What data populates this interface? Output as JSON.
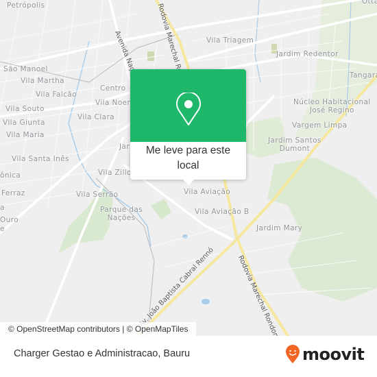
{
  "map": {
    "labels": [
      {
        "text": "Petrópolis"
      },
      {
        "text": "São Manoel"
      },
      {
        "text": "Vila Martha"
      },
      {
        "text": "Vila Falcão"
      },
      {
        "text": "Centro"
      },
      {
        "text": "Vila Noem"
      },
      {
        "text": "Vila Souto"
      },
      {
        "text": "Vila Clara"
      },
      {
        "text": "Vila Giunta"
      },
      {
        "text": "Vila Maria"
      },
      {
        "text": "Vila Santa Inês"
      },
      {
        "text": "ônica"
      },
      {
        "text": "Ferraz"
      },
      {
        "text": "a"
      },
      {
        "text": "Ouro"
      },
      {
        "text": "e"
      },
      {
        "text": "Jar"
      },
      {
        "text": "Vila Zillo"
      },
      {
        "text": "Vila Serrão"
      },
      {
        "text": "Parque das\nNações"
      },
      {
        "text": "Vila Triagem"
      },
      {
        "text": "Jardim Redentor"
      },
      {
        "text": "Tangará"
      },
      {
        "text": "Núcleo Habitacional\nJosé Regino"
      },
      {
        "text": "Vargem Limpa"
      },
      {
        "text": "Jardim Santos\nDumont"
      },
      {
        "text": "Vila Aviação"
      },
      {
        "text": "Vila Aviação B"
      },
      {
        "text": "Jardim Mary"
      },
      {
        "text": "Otta"
      }
    ],
    "road_labels": [
      {
        "text": "Avenida Nações"
      },
      {
        "text": "Rodovia Marechal Rondon"
      },
      {
        "text": "Rodovia Marechal Rondon"
      },
      {
        "text": "Av. João Baptista Cabral Rennó"
      }
    ],
    "attribution": "© OpenStreetMap contributors | © OpenMapTiles"
  },
  "popup": {
    "icon": "map-pin-icon",
    "action_label": "Me leve para este local",
    "accent_color": "#1fb86a"
  },
  "footer": {
    "place_name": "Charger Gestao e Administracao, Bauru",
    "brand": "moovit",
    "brand_color": "#f26522"
  }
}
